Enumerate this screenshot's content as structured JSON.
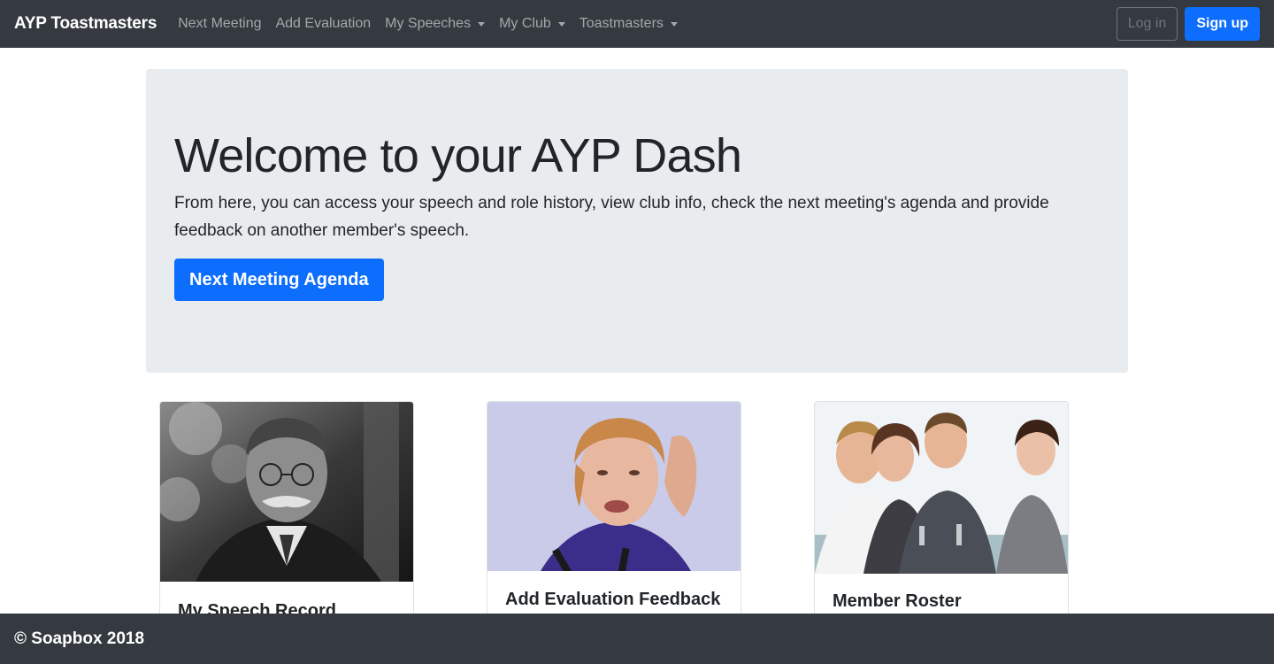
{
  "navbar": {
    "brand": "AYP Toastmasters",
    "links": [
      {
        "label": "Next Meeting"
      },
      {
        "label": "Add Evaluation"
      },
      {
        "label": "My Speeches"
      },
      {
        "label": "My Club"
      },
      {
        "label": "Toastmasters"
      }
    ],
    "login_label": "Log in",
    "signup_label": "Sign up"
  },
  "jumbotron": {
    "title": "Welcome to your AYP Dash",
    "lead": "From here, you can access your speech and role history, view club info, check the next meeting's agenda and provide feedback on another member's speech.",
    "button_label": "Next Meeting Agenda"
  },
  "cards": [
    {
      "title": "My Speech Record"
    },
    {
      "title": "Add Evaluation Feedback"
    },
    {
      "title": "Member Roster"
    }
  ],
  "footer": {
    "text": "© Soapbox 2018"
  },
  "colors": {
    "navbar_bg": "#343a40",
    "primary": "#0d6efd",
    "jumbotron_bg": "#e9ecef"
  }
}
